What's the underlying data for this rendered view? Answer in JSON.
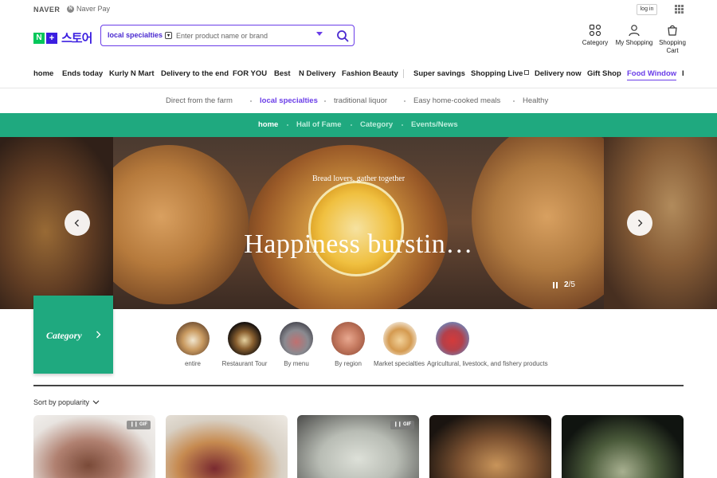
{
  "topbar": {
    "naver": "NAVER",
    "naver_pay": "Naver Pay",
    "login": "log in"
  },
  "brand": {
    "n": "N",
    "plus": "+",
    "store": "스토어"
  },
  "search": {
    "scope": "local specialties",
    "placeholder": "Enter product name or brand"
  },
  "header_actions": [
    {
      "label": "Category",
      "icon": "category-icon"
    },
    {
      "label": "My Shopping",
      "icon": "user-icon"
    },
    {
      "label": "Shopping\nCart",
      "icon": "cart-icon"
    }
  ],
  "main_nav": [
    "home",
    "Ends today",
    "Kurly N Mart",
    "Delivery to the end",
    "FOR YOU",
    "Best",
    "N Delivery",
    "Fashion Beauty",
    "Super savings",
    "Shopping Live",
    "Delivery now",
    "Gift Shop",
    "Food Window",
    "I"
  ],
  "main_nav_active": "Food Window",
  "sub_nav": [
    "Direct from the farm",
    "local specialties",
    "traditional liquor",
    "Easy home-cooked meals",
    "Healthy"
  ],
  "sub_nav_active": "local specialties",
  "green_nav": [
    "home",
    "Hall of Fame",
    "Category",
    "Events/News"
  ],
  "green_nav_active": "home",
  "hero": {
    "small_text": "Bread lovers, gather together",
    "big_text": "Happiness burstin…",
    "current": "2",
    "total": "/5"
  },
  "category": {
    "title": "Category",
    "items": [
      "entire",
      "Restaurant Tour",
      "By menu",
      "By region",
      "Market specialties",
      "Agricultural, livestock, and fishery products"
    ]
  },
  "sort": {
    "label": "Sort by popularity"
  },
  "cards": [
    {
      "badge": "GIF"
    },
    {
      "badge": ""
    },
    {
      "badge": "GIF"
    },
    {
      "badge": ""
    },
    {
      "badge": ""
    }
  ],
  "colors": {
    "accent": "#6a3de8",
    "green": "#1fa97f"
  }
}
